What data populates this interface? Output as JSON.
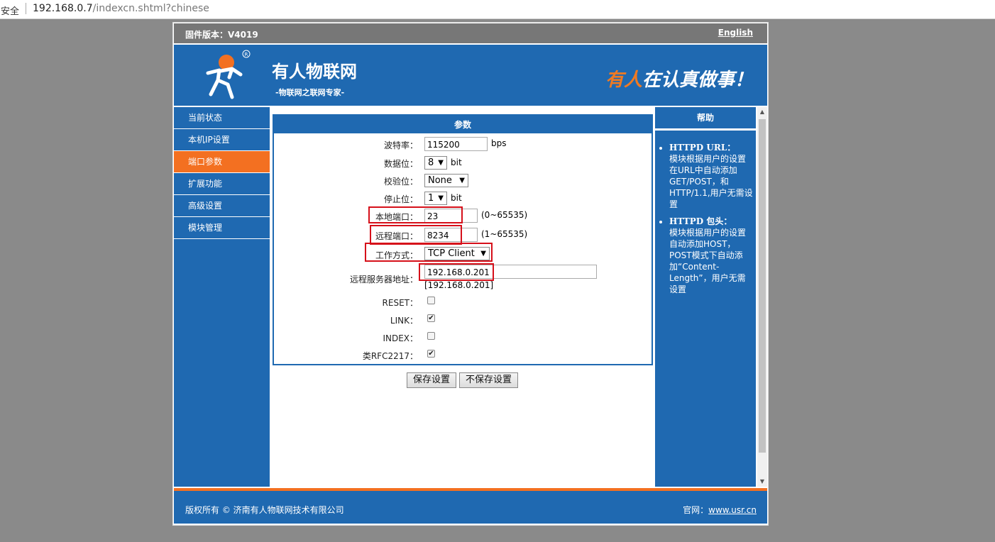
{
  "browser": {
    "security": "安全",
    "url_host": "192.168.0.7",
    "url_path": "/indexcn.shtml?chinese"
  },
  "topbar": {
    "firmware": "固件版本：V4019",
    "language_link": "English"
  },
  "banner": {
    "brand": "有人物联网",
    "tagline": "-物联网之联网专家-",
    "slogan_orange": "有人",
    "slogan_white": "在认真做事！"
  },
  "sidebar": {
    "items": [
      {
        "label": "当前状态"
      },
      {
        "label": "本机IP设置"
      },
      {
        "label": "端口参数"
      },
      {
        "label": "扩展功能"
      },
      {
        "label": "高级设置"
      },
      {
        "label": "模块管理"
      }
    ],
    "active_index": 2
  },
  "panel": {
    "title": "参数",
    "baud_label": "波特率：",
    "baud_value": "115200",
    "baud_unit": "bps",
    "databits_label": "数据位：",
    "databits_value": "8",
    "databits_unit": "bit",
    "parity_label": "校验位：",
    "parity_value": "None",
    "stopbits_label": "停止位：",
    "stopbits_value": "1",
    "stopbits_unit": "bit",
    "localport_label": "本地端口：",
    "localport_value": "23",
    "localport_range": "(0~65535)",
    "remoteport_label": "远程端口：",
    "remoteport_value": "8234",
    "remoteport_range": "(1~65535)",
    "mode_label": "工作方式：",
    "mode_value": "TCP Client",
    "server_label": "远程服务器地址：",
    "server_value": "192.168.0.201",
    "server_current": "[192.168.0.201]",
    "reset_label": "RESET：",
    "reset_checked": false,
    "link_label": "LINK：",
    "link_checked": true,
    "index_label": "INDEX：",
    "index_checked": false,
    "rfc_label": "类RFC2217：",
    "rfc_checked": true
  },
  "buttons": {
    "save": "保存设置",
    "nosave": "不保存设置"
  },
  "help": {
    "title": "帮助",
    "items": [
      {
        "head": "HTTPD URL：",
        "body": "模块根据用户的设置在URL中自动添加GET/POST，和HTTP/1.1,用户无需设置"
      },
      {
        "head": "HTTPD 包头：",
        "body": "模块根据用户的设置自动添加HOST，POST模式下自动添加“Content-Length”，用户无需设置"
      }
    ]
  },
  "footer": {
    "copyright": "版权所有 © 济南有人物联网技术有限公司",
    "site_label": "官网：",
    "site_link": "www.usr.cn"
  },
  "colors": {
    "blue": "#1f69b1",
    "orange": "#f37021",
    "highlight": "#d6101a"
  }
}
